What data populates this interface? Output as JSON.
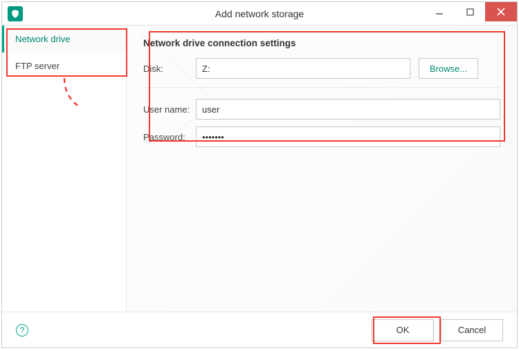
{
  "window": {
    "title": "Add network storage"
  },
  "sidebar": {
    "items": [
      {
        "label": "Network drive",
        "active": true
      },
      {
        "label": "FTP server",
        "active": false
      }
    ]
  },
  "form": {
    "section_title": "Network drive connection settings",
    "disk_label": "Disk:",
    "disk_value": "Z:",
    "browse_label": "Browse...",
    "username_label": "User name:",
    "username_value": "user",
    "password_label": "Password:",
    "password_value": "•••••••"
  },
  "footer": {
    "ok_label": "OK",
    "cancel_label": "Cancel",
    "help_tooltip": "?"
  },
  "colors": {
    "accent": "#00a88a",
    "highlight": "#f33a2f",
    "close_bg": "#d9534f"
  }
}
